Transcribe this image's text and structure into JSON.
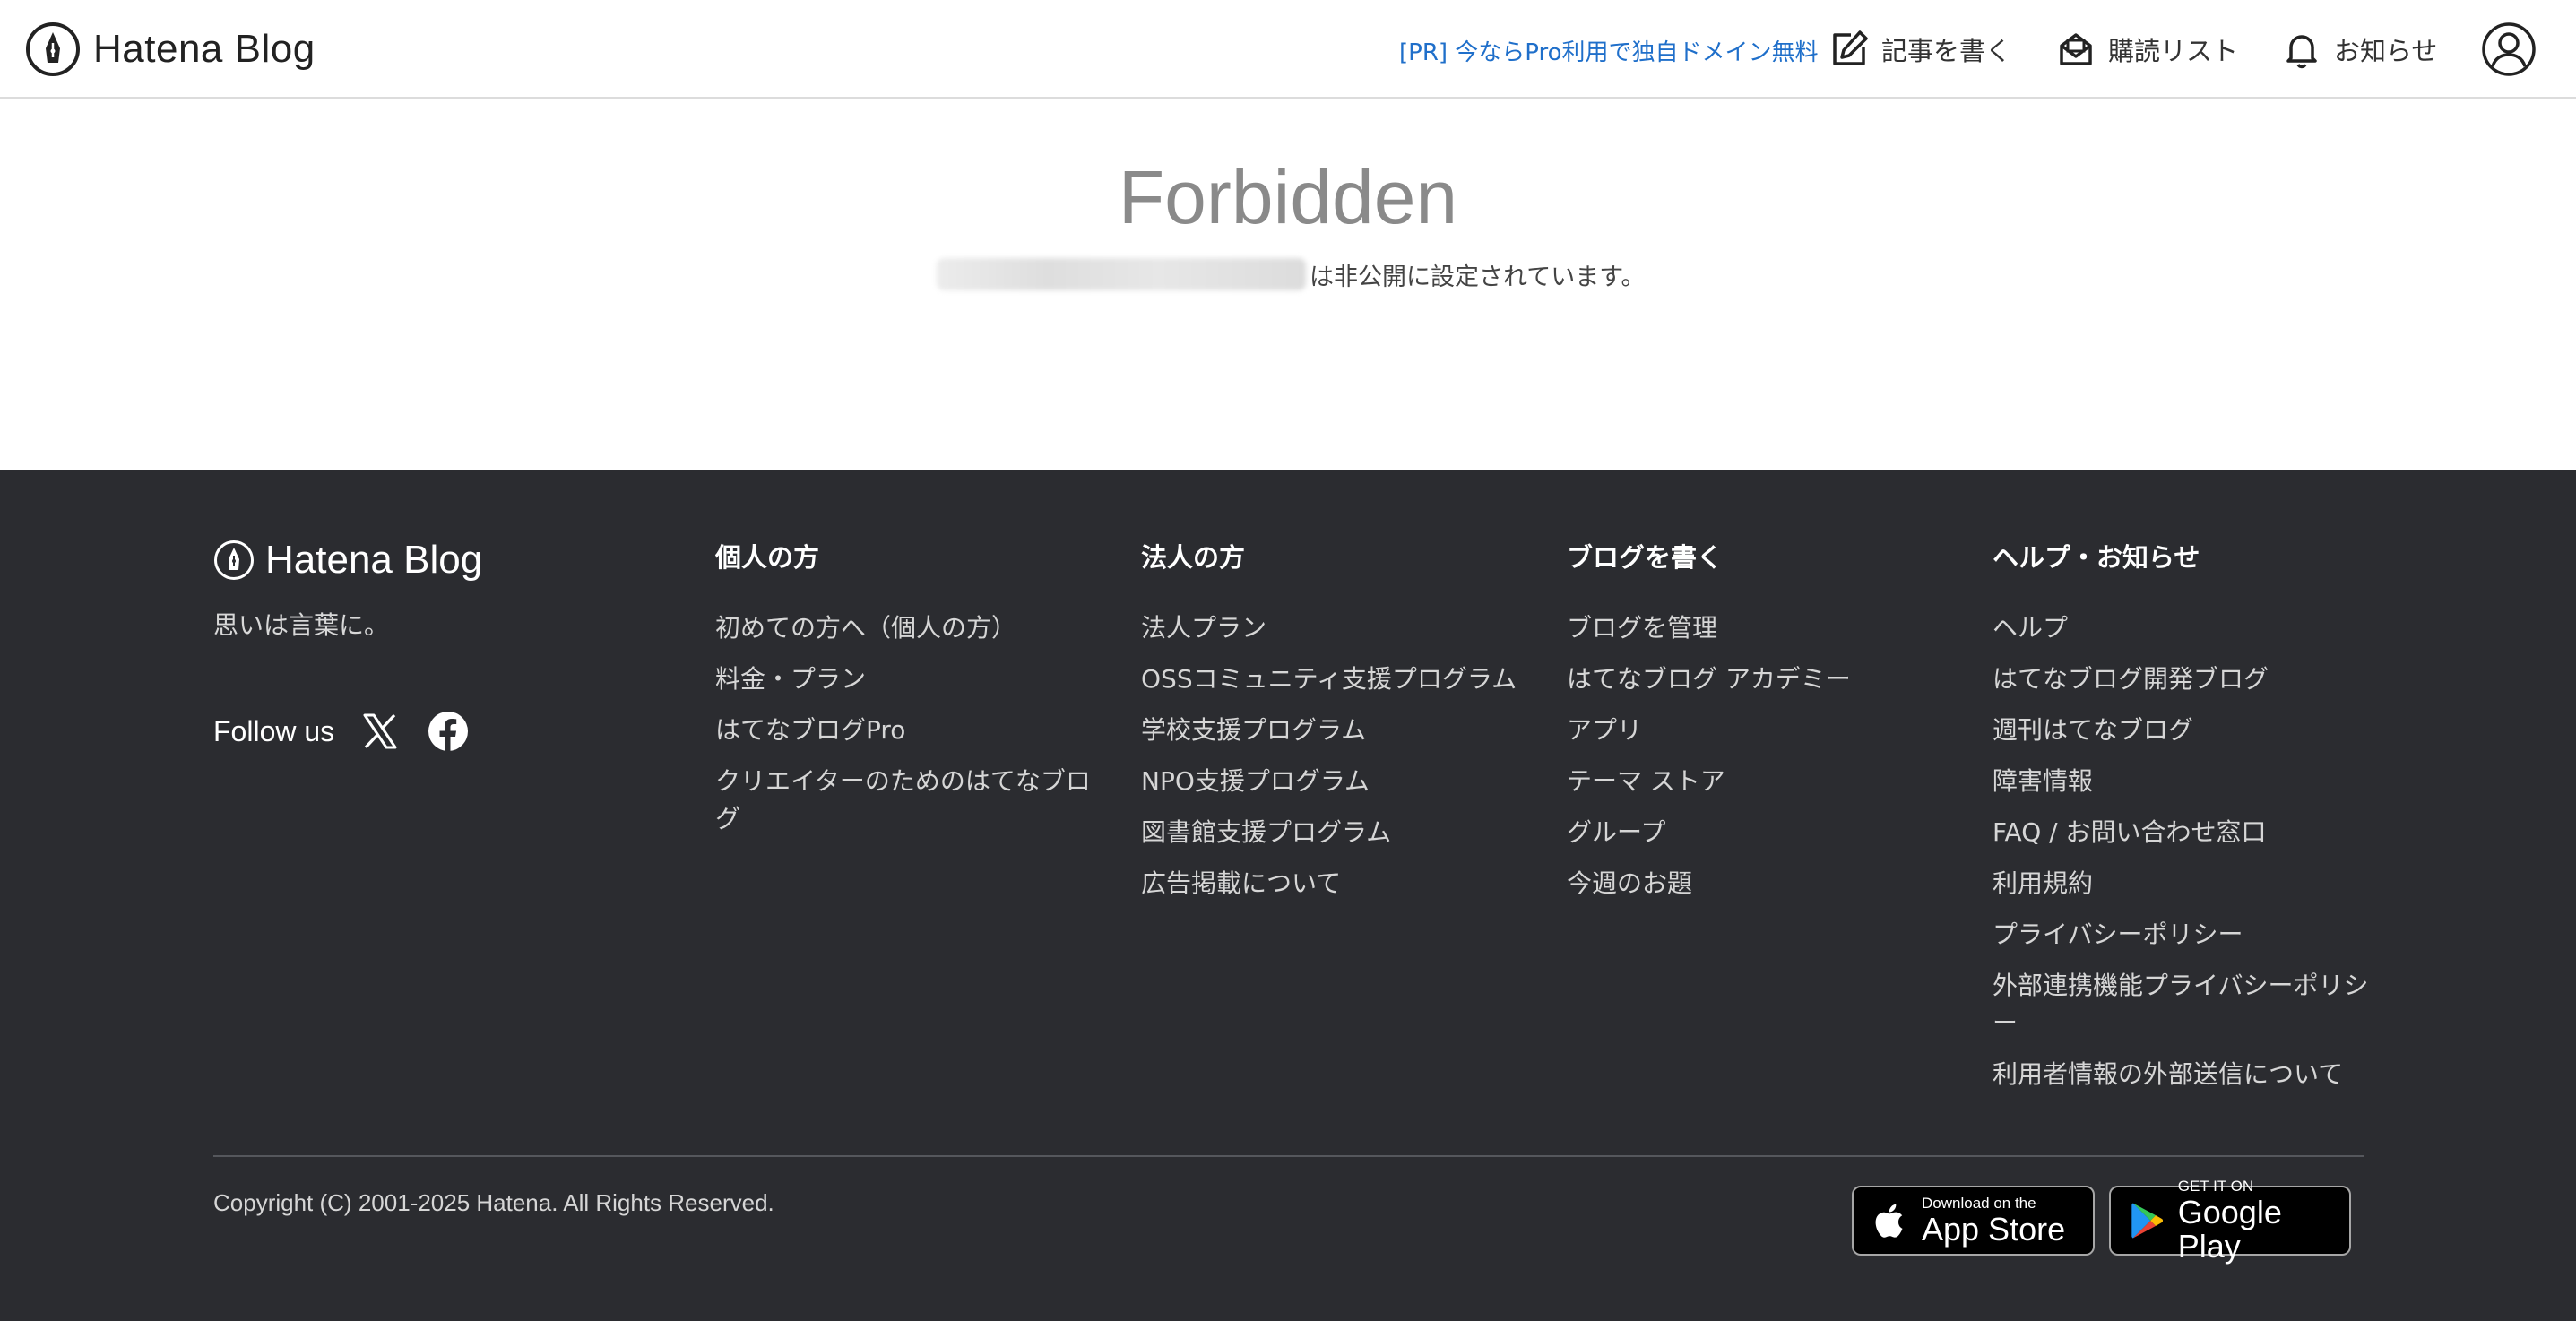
{
  "header": {
    "logo_text": "Hatena Blog",
    "pr_link": "[PR] 今ならPro利用で独自ドメイン無料",
    "write_label": "記事を書く",
    "subscriptions_label": "購読リスト",
    "notifications_label": "お知らせ"
  },
  "main": {
    "title": "Forbidden",
    "message": "は非公開に設定されています。"
  },
  "footer": {
    "logo_text": "Hatena Blog",
    "tagline": "思いは言葉に。",
    "follow_label": "Follow us",
    "columns": [
      {
        "heading": "個人の方",
        "links": [
          "初めての方へ（個人の方）",
          "料金・プラン",
          "はてなブログPro",
          "クリエイターのためのはてなブログ"
        ]
      },
      {
        "heading": "法人の方",
        "links": [
          "法人プラン",
          "OSSコミュニティ支援プログラム",
          "学校支援プログラム",
          "NPO支援プログラム",
          "図書館支援プログラム",
          "広告掲載について"
        ]
      },
      {
        "heading": "ブログを書く",
        "links": [
          "ブログを管理",
          "はてなブログ アカデミー",
          "アプリ",
          "テーマ ストア",
          "グループ",
          "今週のお題"
        ]
      },
      {
        "heading": "ヘルプ・お知らせ",
        "links": [
          "ヘルプ",
          "はてなブログ開発ブログ",
          "週刊はてなブログ",
          "障害情報",
          "FAQ / お問い合わせ窓口",
          "利用規約",
          "プライバシーポリシー",
          "外部連携機能プライバシーポリシー",
          "利用者情報の外部送信について"
        ]
      }
    ],
    "copyright": "Copyright (C) 2001-2025 Hatena. All Rights Reserved.",
    "appstore": {
      "small": "Download on the",
      "big": "App Store"
    },
    "googleplay": {
      "small": "GET IT ON",
      "big": "Google Play"
    }
  }
}
